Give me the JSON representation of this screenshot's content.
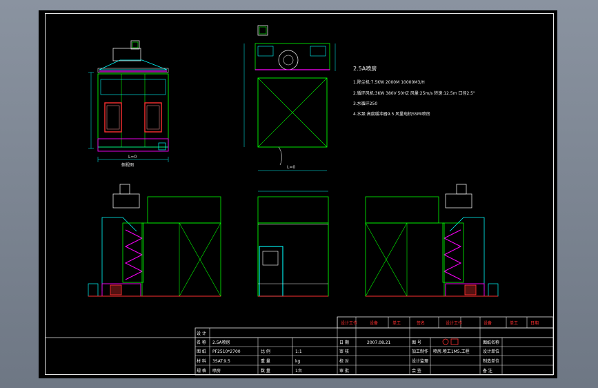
{
  "drawing": {
    "notes_title": "2.5A喷房",
    "notes": [
      "1.除尘机:7.5KW 2000M 10000M3/H",
      "2.循环风机:3KW 380V 50HZ 风量:25m/s 转速:12.5m 口径2.5\"",
      "3.水循环250",
      "4.水泵:高度缓冲器9.5 风量电机SSMI喷房"
    ],
    "view_label_front": "侧视图",
    "dim_label": "L=0"
  },
  "title_block": {
    "rev_headers": [
      "设计工作",
      "设备",
      "单工",
      "签名",
      "设计工作",
      "设备",
      "单工",
      "日期"
    ],
    "left_rows": [
      {
        "label": "设 计",
        "value": ""
      },
      {
        "label": "名 称",
        "value": "2.5A喷房"
      },
      {
        "label": "图 纸",
        "value": "PF2510*2700"
      },
      {
        "label": "材 料",
        "value": "3SAT.9.5"
      },
      {
        "label": "规 格",
        "value": "喷房"
      }
    ],
    "left_mid": [
      {
        "label": "比 例",
        "value": "1:1"
      },
      {
        "label": "重 量",
        "value": "kg"
      },
      {
        "label": "数 量",
        "value": "1台"
      }
    ],
    "mid_rows": [
      {
        "label": "日 期",
        "value": "2007.08.21"
      },
      {
        "label": "审 核",
        "value": ""
      },
      {
        "label": "校 对",
        "value": ""
      },
      {
        "label": "审 批",
        "value": ""
      }
    ],
    "mid_labels2": [
      "图 号",
      "加工制作",
      "设计监理",
      "会 签"
    ],
    "company_note": "喷房.喷工1M5.工程",
    "right_rows": [
      "图纸名称",
      "设计单位",
      "制造单位",
      "备 注"
    ]
  }
}
